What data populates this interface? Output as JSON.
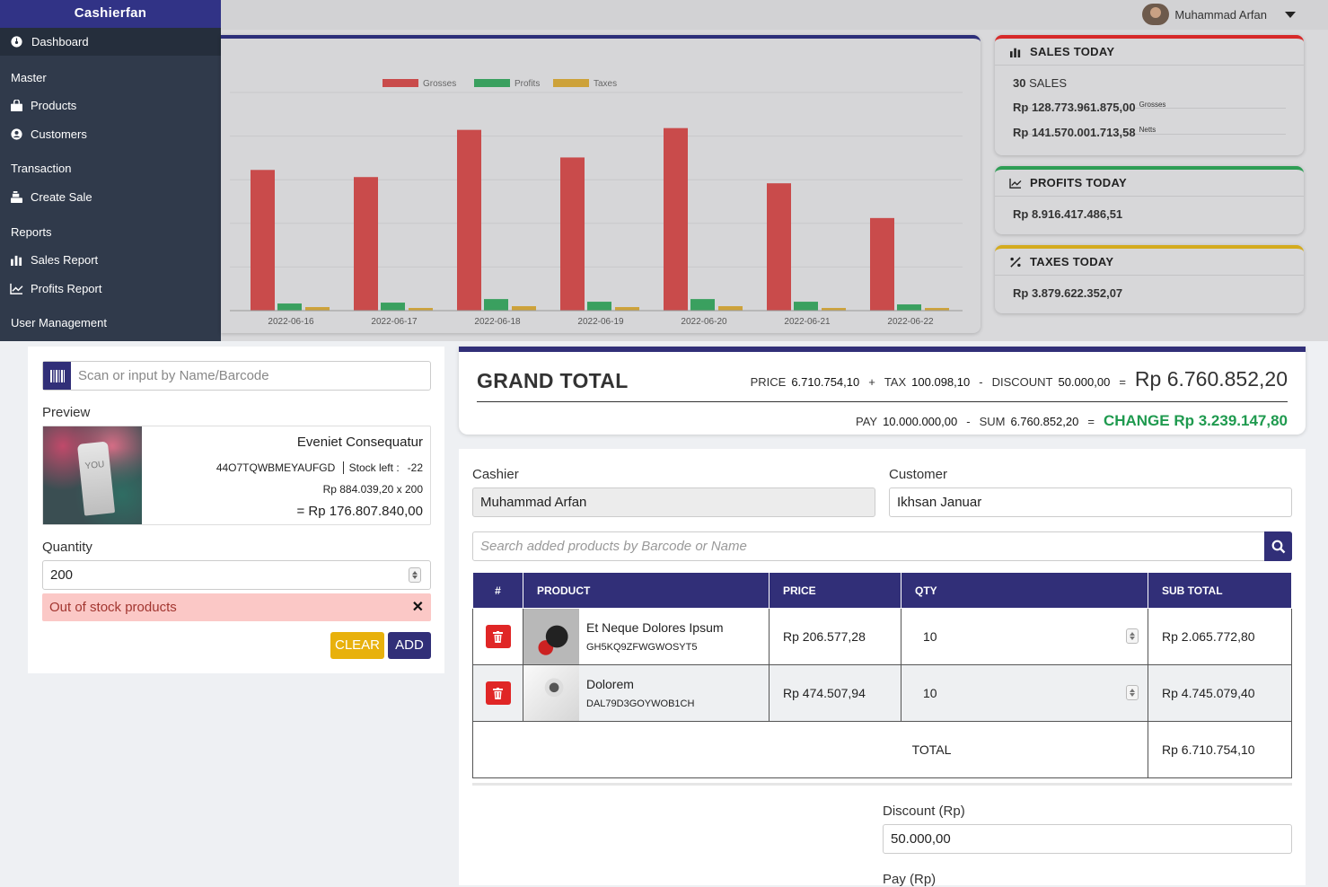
{
  "app": {
    "brand": "Cashierfan",
    "user": "Muhammad Arfan"
  },
  "sidebar": {
    "dashboard": "Dashboard",
    "sections": [
      {
        "label": "Master"
      },
      {
        "label": "Transaction"
      },
      {
        "label": "Reports"
      },
      {
        "label": "User Management"
      }
    ],
    "items": [
      {
        "label": "Products",
        "icon": "shopping-bag-icon"
      },
      {
        "label": "Customers",
        "icon": "user-circle-icon"
      },
      {
        "label": "Create Sale",
        "icon": "cash-register-icon"
      },
      {
        "label": "Sales Report",
        "icon": "bar-chart-icon"
      },
      {
        "label": "Profits Report",
        "icon": "line-chart-icon"
      }
    ]
  },
  "chart_data": {
    "type": "bar",
    "categories": [
      "2022-06-16",
      "2022-06-17",
      "2022-06-18",
      "2022-06-19",
      "2022-06-20",
      "2022-06-21",
      "2022-06-22"
    ],
    "series": [
      {
        "name": "Grosses",
        "color": "#c94b4b",
        "values": [
          158,
          150,
          203,
          172,
          205,
          143,
          104
        ]
      },
      {
        "name": "Profits",
        "color": "#3aa05f",
        "values": [
          8,
          9,
          13,
          10,
          13,
          10,
          7
        ]
      },
      {
        "name": "Taxes",
        "color": "#cda23a",
        "values": [
          4,
          3,
          5,
          4,
          5,
          3,
          3
        ]
      }
    ],
    "ylim": [
      0,
      245
    ],
    "legend": "top",
    "grid": true
  },
  "cards": {
    "sales": {
      "title": "SALES TODAY",
      "count": "30",
      "count_suffix": "SALES",
      "grosses": "Rp 128.773.961.875,00",
      "grosses_note": "Grosses",
      "netts": "Rp 141.570.001.713,58",
      "netts_note": "Netts",
      "color": "#d72a2a"
    },
    "profits": {
      "title": "PROFITS TODAY",
      "value": "Rp 8.916.417.486,51",
      "color": "#2e9e55"
    },
    "taxes": {
      "title": "TAXES TODAY",
      "value": "Rp 3.879.622.352,07",
      "color": "#d4ab1e"
    }
  },
  "pos": {
    "scan_placeholder": "Scan or input by Name/Barcode",
    "preview_label": "Preview",
    "preview": {
      "name": "Eveniet Consequatur",
      "code": "44O7TQWBMEYAUFGD",
      "stock_label": "Stock left :",
      "stock": "-22",
      "price_calc": "Rp 884.039,20 x 200",
      "total": "= Rp 176.807.840,00",
      "brand_text": "YOU"
    },
    "quantity_label": "Quantity",
    "quantity": "200",
    "alert": "Out of stock products",
    "clear": "CLEAR",
    "add": "ADD"
  },
  "totals": {
    "title": "GRAND TOTAL",
    "price_label": "PRICE",
    "price": "6.710.754,10",
    "tax_label": "TAX",
    "tax": "100.098,10",
    "discount_label": "DISCOUNT",
    "discount": "50.000,00",
    "grand": "Rp 6.760.852,20",
    "pay_label": "PAY",
    "pay": "10.000.000,00",
    "sum_label": "SUM",
    "sum": "6.760.852,20",
    "change": "CHANGE Rp 3.239.147,80",
    "plus": "+",
    "minus": "-",
    "equals": "="
  },
  "sale": {
    "cashier_label": "Cashier",
    "cashier": "Muhammad Arfan",
    "customer_label": "Customer",
    "customer": "Ikhsan Januar",
    "search_placeholder": "Search added products by Barcode or Name",
    "columns": [
      "#",
      "PRODUCT",
      "PRICE",
      "QTY",
      "SUB TOTAL"
    ],
    "rows": [
      {
        "name": "Et Neque Dolores Ipsum",
        "code": "GH5KQ9ZFWGWOSYT5",
        "price": "Rp 206.577,28",
        "qty": "10",
        "subtotal": "Rp 2.065.772,80"
      },
      {
        "name": "Dolorem",
        "code": "DAL79D3GOYWOB1CH",
        "price": "Rp 474.507,94",
        "qty": "10",
        "subtotal": "Rp 4.745.079,40"
      }
    ],
    "total_label": "TOTAL",
    "total": "Rp 6.710.754,10",
    "discount_label": "Discount (Rp)",
    "discount": "50.000,00",
    "pay_label": "Pay (Rp)"
  }
}
